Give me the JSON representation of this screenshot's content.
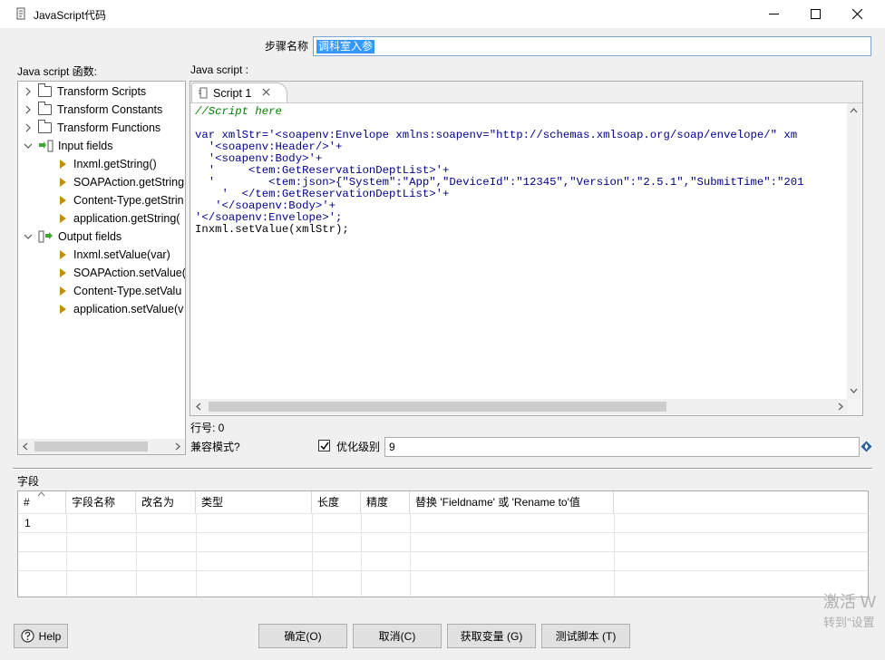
{
  "window": {
    "title": "JavaScript代码",
    "minimize_icon": "minimize-icon",
    "maximize_icon": "maximize-icon",
    "close_icon": "close-icon"
  },
  "step_name": {
    "label": "步骤名称",
    "value": "调科室入参"
  },
  "functions_panel": {
    "label": "Java script 函数:",
    "tree": [
      {
        "label": "Transform Scripts",
        "icon": "folder-icon",
        "expanded": false
      },
      {
        "label": "Transform Constants",
        "icon": "folder-icon",
        "expanded": false
      },
      {
        "label": "Transform Functions",
        "icon": "folder-icon",
        "expanded": false
      },
      {
        "label": "Input fields",
        "icon": "input-fields-icon",
        "expanded": true
      },
      {
        "label": "Inxml.getString()",
        "icon": "field-icon"
      },
      {
        "label": "SOAPAction.getString",
        "icon": "field-icon"
      },
      {
        "label": "Content-Type.getStrin",
        "icon": "field-icon"
      },
      {
        "label": "application.getString(",
        "icon": "field-icon"
      },
      {
        "label": "Output fields",
        "icon": "output-fields-icon",
        "expanded": true
      },
      {
        "label": "Inxml.setValue(var)",
        "icon": "field-icon"
      },
      {
        "label": "SOAPAction.setValue(",
        "icon": "field-icon"
      },
      {
        "label": "Content-Type.setValu",
        "icon": "field-icon"
      },
      {
        "label": "application.setValue(v",
        "icon": "field-icon"
      }
    ]
  },
  "script_panel": {
    "label": "Java script :",
    "tab_label": "Script 1",
    "lines": [
      "//Script here",
      "",
      "var xmlStr='<soapenv:Envelope xmlns:soapenv=\"http://schemas.xmlsoap.org/soap/envelope/\" xm",
      "  '<soapenv:Header/>'+",
      "  '<soapenv:Body>'+",
      "  '     <tem:GetReservationDeptList>'+",
      "  '        <tem:json>{\"System\":\"App\",\"DeviceId\":\"12345\",\"Version\":\"2.5.1\",\"SubmitTime\":\"201",
      "    '  </tem:GetReservationDeptList>'+",
      "   '</soapenv:Body>'+",
      "'</soapenv:Envelope>';",
      "Inxml.setValue(xmlStr);"
    ]
  },
  "line_number": "行号: 0",
  "compat_label": "兼容模式?",
  "optimization": {
    "checked": true,
    "label": "优化级别",
    "value": "9"
  },
  "fields": {
    "label": "字段",
    "columns": [
      "#",
      "字段名称",
      "改名为",
      "类型",
      "长度",
      "精度",
      "替换 'Fieldname' 或 'Rename to'值"
    ],
    "rows": [
      [
        "1",
        "",
        "",
        "",
        "",
        "",
        ""
      ]
    ]
  },
  "buttons": {
    "help": "Help",
    "ok": "确定(O)",
    "cancel": "取消(C)",
    "get_vars": "获取变量 (G)",
    "test": "测试脚本 (T)"
  },
  "watermark": {
    "line1": "激活 W",
    "line2": "转到\"设置"
  },
  "colors": {
    "selection": "#3399ff",
    "input_border": "#7aa7d8",
    "keyword": "#00007f",
    "comment": "#008000",
    "field_marker": "#c09000"
  }
}
